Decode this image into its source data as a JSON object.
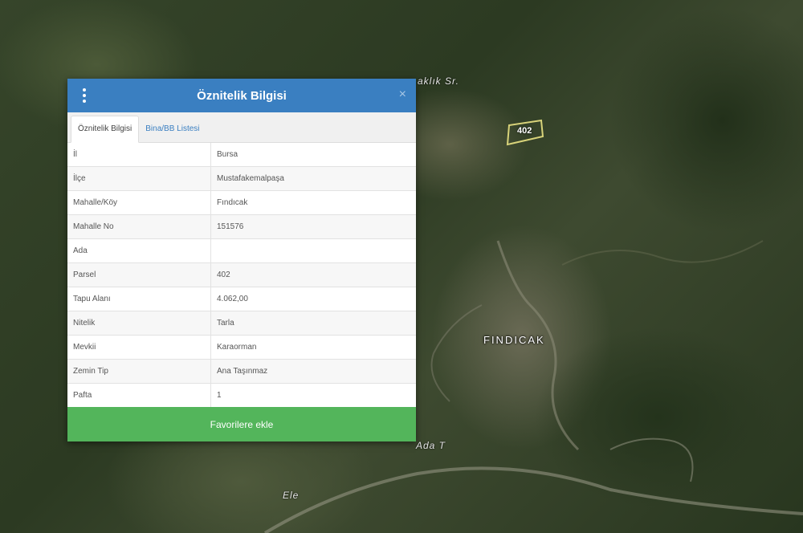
{
  "map": {
    "street_label_1": "aklık Sr.",
    "street_label_2": "Ada T",
    "street_label_3": "Ele",
    "village_label": "FINDICAK",
    "parcel_tag": "402",
    "parcel_outline_color": "#d8d37a"
  },
  "popup": {
    "title": "Öznitelik Bilgisi",
    "menu_icon": "kebab-menu-icon",
    "close_icon": "close-icon",
    "close_glyph": "×",
    "header_color": "#3a7fc1",
    "tabs": [
      {
        "label": "Öznitelik Bilgisi",
        "active": true
      },
      {
        "label": "Bina/BB Listesi",
        "active": false
      }
    ],
    "rows": [
      {
        "key": "İl",
        "value": "Bursa"
      },
      {
        "key": "İlçe",
        "value": "Mustafakemalpaşa"
      },
      {
        "key": "Mahalle/Köy",
        "value": "Fındıcak"
      },
      {
        "key": "Mahalle No",
        "value": "151576"
      },
      {
        "key": "Ada",
        "value": ""
      },
      {
        "key": "Parsel",
        "value": "402"
      },
      {
        "key": "Tapu Alanı",
        "value": "4.062,00"
      },
      {
        "key": "Nitelik",
        "value": "Tarla"
      },
      {
        "key": "Mevkii",
        "value": "Karaorman"
      },
      {
        "key": "Zemin Tip",
        "value": "Ana Taşınmaz"
      },
      {
        "key": "Pafta",
        "value": "1"
      }
    ],
    "favorite_button": "Favorilere ekle",
    "favorite_color": "#53b55b"
  }
}
